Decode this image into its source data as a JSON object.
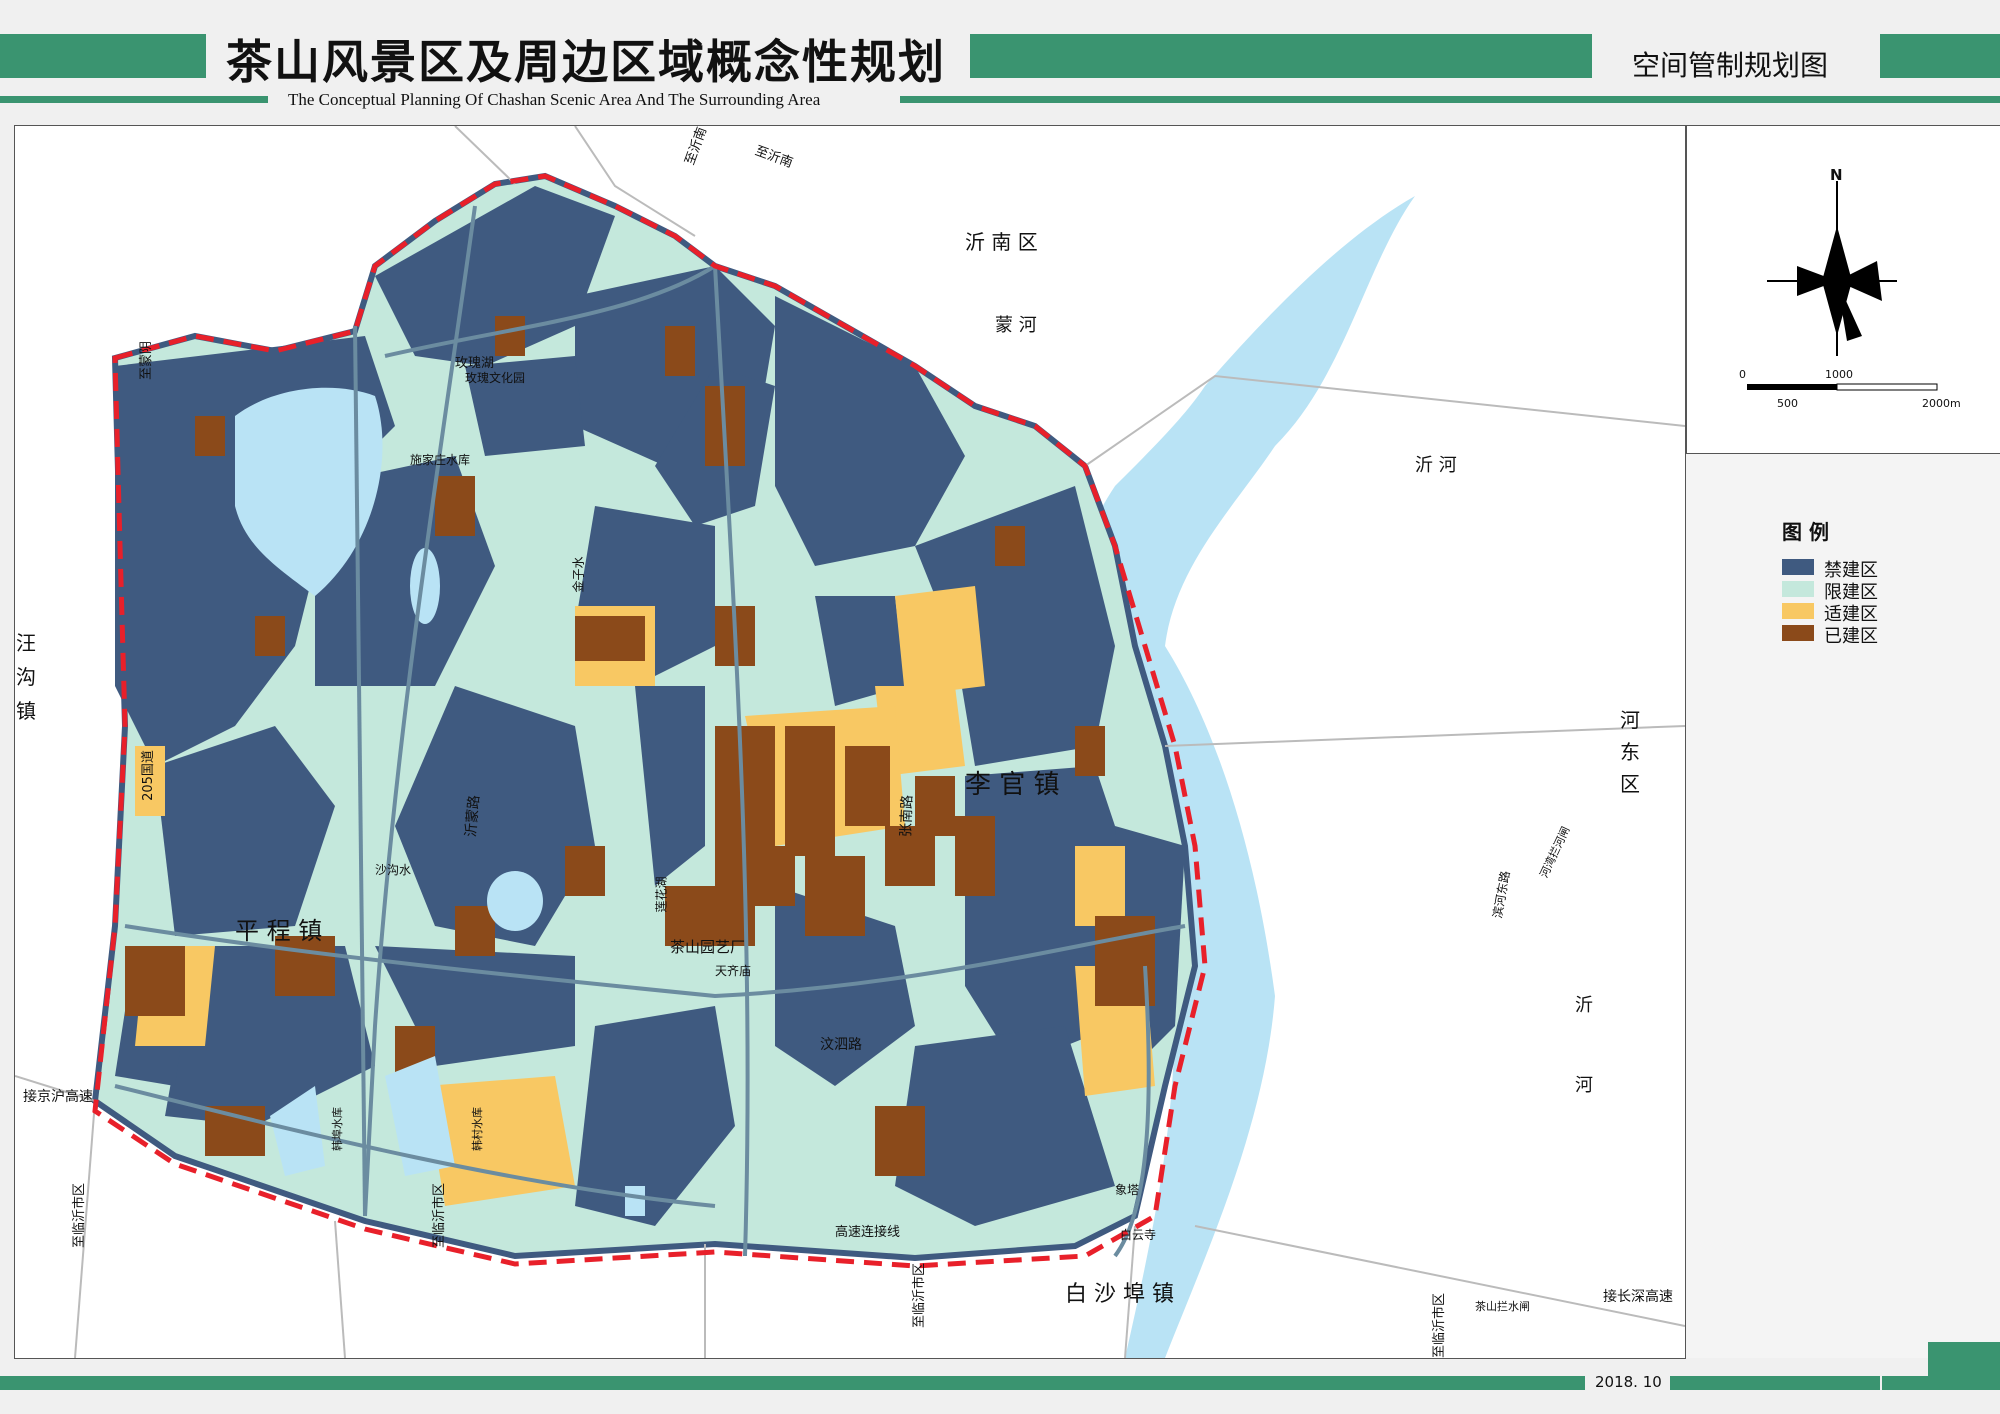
{
  "header": {
    "title_cn": "茶山风景区及周边区域概念性规划",
    "title_en": "The Conceptual Planning Of Chashan Scenic Area And The Surrounding Area",
    "map_subtitle": "空间管制规划图"
  },
  "compass": {
    "north": "N"
  },
  "scale_bar": {
    "t0": "0",
    "t1000": "1000",
    "t500": "500",
    "t2000": "2000m"
  },
  "legend": {
    "title": "图 例",
    "items": [
      {
        "label": "禁建区",
        "color": "#3f5a80"
      },
      {
        "label": "限建区",
        "color": "#c4e8dc"
      },
      {
        "label": "适建区",
        "color": "#f8c863"
      },
      {
        "label": "已建区",
        "color": "#8b4a1a"
      }
    ]
  },
  "footer": {
    "date": "2018. 10"
  },
  "map_labels": {
    "yinan_district": "沂 南 区",
    "wanggou_town": "汪 沟 镇",
    "hedong_district": "河 东 区",
    "baishabu_town": "白 沙 埠 镇",
    "liguan_town": "李 官 镇",
    "pingcheng_town": "平 程 镇",
    "meng_river": "蒙 河",
    "yi_river_top": "沂 河",
    "yi_river_right": "沂 河",
    "to_yinan_1": "至沂南",
    "to_yinan_2": "至沂南",
    "to_mengyin": "至蒙阴",
    "national_road_205": "205国道",
    "yimeng_road": "沂蒙路",
    "zhangnan_road": "张南路",
    "wensi_road": "汶泗路",
    "jinghu_expressway": "接京沪高速",
    "changshen_expressway": "接长深高速",
    "to_linyi_1": "至临沂市区",
    "to_linyi_2": "至临沂市区",
    "to_linyi_3": "至临沂市区",
    "to_linyi_4": "至临沂市区",
    "expressway_link": "高速连接线",
    "shijiazhuang_reservoir": "施家庄水库",
    "meiguihu": "玫瑰湖",
    "meiguihu_park": "玫瑰文化园",
    "jinzi_water": "金子水",
    "lianhua_lake": "莲花湖",
    "chashan_garden": "茶山园艺厂",
    "tianqi_temple": "天齐庙",
    "shagou_water": "沙沟水",
    "hanfang_reservoir": "韩埠水库",
    "hancun_reservoir": "韩村水库",
    "xiangta": "象塔",
    "baiyunsi": "白云寺",
    "hewan_dam": "河湾拦河闸",
    "chashan_dam": "茶山拦水闸",
    "binhe_road": "滨河东路"
  }
}
